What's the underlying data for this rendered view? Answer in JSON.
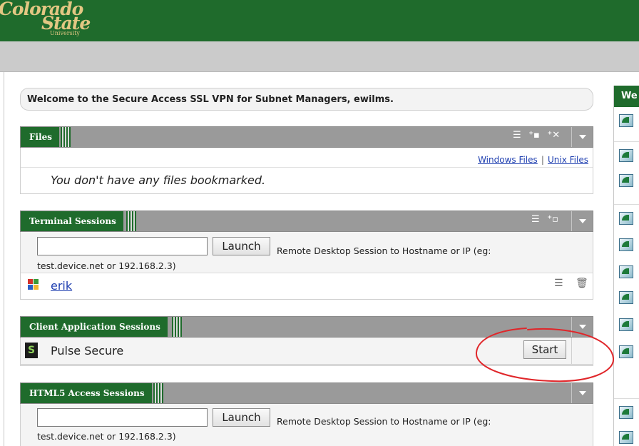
{
  "header": {
    "logo_line1": "Colorado",
    "logo_line2": "State",
    "logo_line3": "University"
  },
  "welcome_text": "Welcome to the Secure Access SSL VPN for Subnet Managers, ewilms.",
  "files": {
    "title": "Files",
    "link_windows": "Windows Files",
    "link_separator": "|",
    "link_unix": "Unix Files",
    "empty_message": "You don't have any files bookmarked."
  },
  "terminal": {
    "title": "Terminal Sessions",
    "launch_label": "Launch",
    "description": "Remote Desktop Session to Hostname or IP (eg: test.device.net or 192.168.2.3)",
    "input_value": "",
    "bookmark_name": "erik"
  },
  "client_apps": {
    "title": "Client Application Sessions",
    "app_name": "Pulse Secure",
    "start_label": "Start"
  },
  "html5": {
    "title": "HTML5 Access Sessions",
    "launch_label": "Launch",
    "description": "Remote Desktop Session to Hostname or IP (eg: test.device.net or 192.168.2.3)",
    "input_value": ""
  },
  "right_panel": {
    "title": "We"
  },
  "colors": {
    "brand_green": "#1f6b2c",
    "logo_gold": "#e3c783",
    "header_gray": "#9a9a9a",
    "annotation_red": "#e0262a"
  }
}
